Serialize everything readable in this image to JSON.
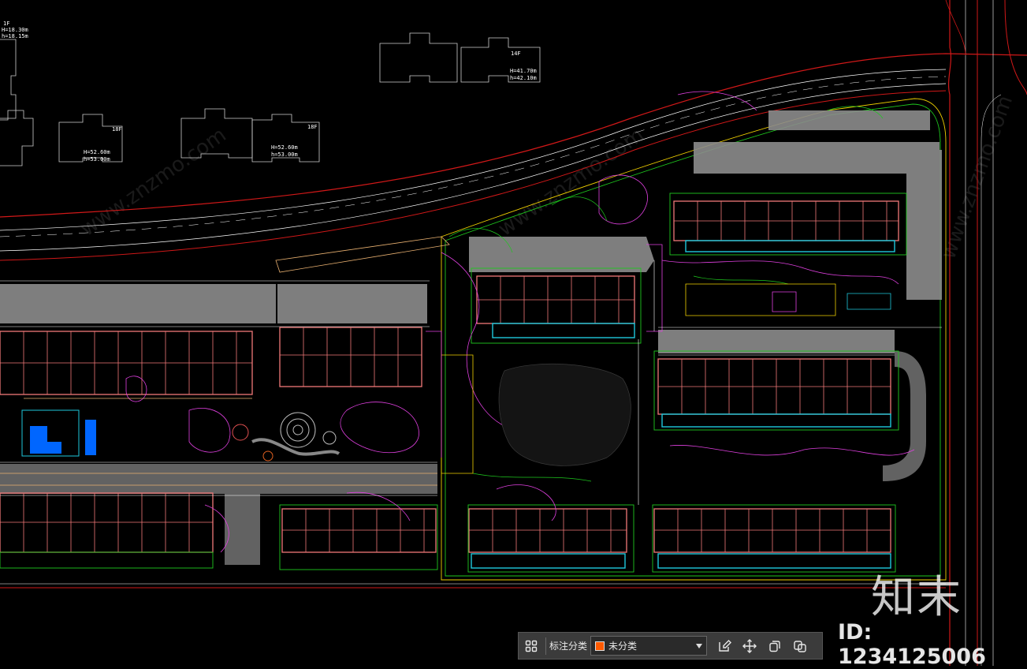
{
  "drawing": {
    "building_labels": [
      {
        "floors": "1F",
        "h1": "H=18.30m",
        "h2": "h=18.15m"
      },
      {
        "floors": "18F",
        "h1": "H=52.60m",
        "h2": "h=53.00m"
      },
      {
        "floors": "18F",
        "h1": "H=52.60m",
        "h2": "h=53.00m"
      },
      {
        "floors": "14F",
        "h1": "H=41.70m",
        "h2": "h=42.10m"
      }
    ]
  },
  "toolbar": {
    "category_label": "标注分类",
    "category_value": "未分类",
    "swatch_color": "#ff5a00"
  },
  "watermark": {
    "logo": "知末",
    "id": "ID: 1234125006",
    "diagonal": "www.znzmo.com"
  },
  "colors": {
    "background": "#000000",
    "building": "#f07878",
    "road_boundary": "#d01818",
    "curb": "#ffffff",
    "plaza": "#8c8c8c",
    "landscape": "#e040e0",
    "greenline": "#1ec81e",
    "cyan": "#1ec8dc"
  }
}
